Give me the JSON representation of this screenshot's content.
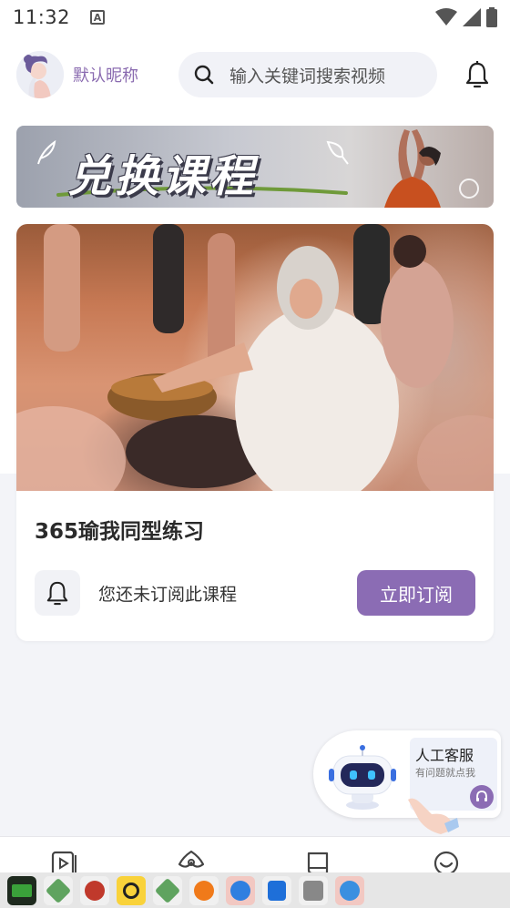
{
  "status_bar": {
    "time": "11:32",
    "a_badge": "A"
  },
  "header": {
    "nickname": "默认昵称",
    "search_placeholder": "输入关键词搜索视频"
  },
  "banner": {
    "title": "兑换课程"
  },
  "course": {
    "title": "365瑜我同型练习",
    "subscribe_status": "您还未订阅此课程",
    "subscribe_button": "立即订阅"
  },
  "customer_service": {
    "title": "人工客服",
    "subtitle": "有问题就点我"
  },
  "icons": {
    "search": "search-icon",
    "notification": "bell-icon",
    "wifi": "wifi-icon",
    "signal": "signal-icon",
    "battery": "battery-icon",
    "nav": [
      "video-icon",
      "yoga-icon",
      "book-icon",
      "smile-icon"
    ]
  },
  "colors": {
    "accent": "#8b6cb4",
    "nickname": "#8a6bb0",
    "background": "#f3f4f8"
  }
}
